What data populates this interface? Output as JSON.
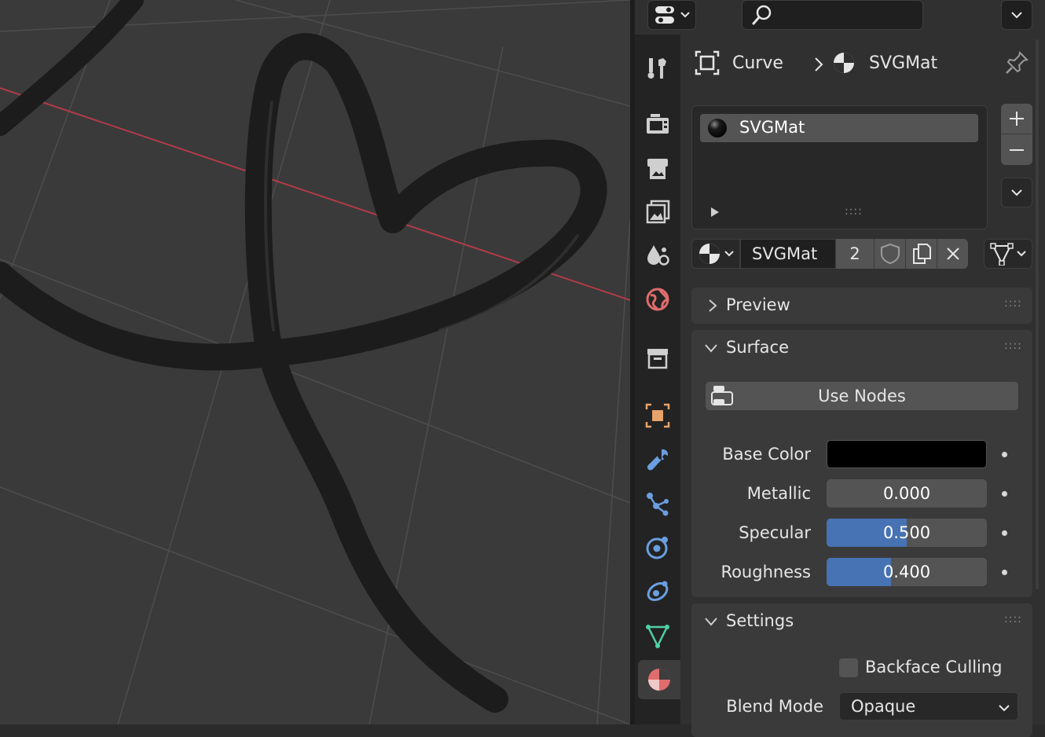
{
  "header": {
    "editor_type_icon": "editor-type-icon",
    "search_placeholder": "",
    "menu_icon": "chevron-down-icon"
  },
  "tabs": [
    {
      "name": "tool",
      "icon": "tool-icon",
      "color": "#cfcfcf"
    },
    {
      "name": "render",
      "icon": "render-icon",
      "color": "#cfcfcf"
    },
    {
      "name": "output",
      "icon": "output-icon",
      "color": "#cfcfcf"
    },
    {
      "name": "view-layer",
      "icon": "view-layer-icon",
      "color": "#cfcfcf"
    },
    {
      "name": "scene",
      "icon": "scene-icon",
      "color": "#cfcfcf"
    },
    {
      "name": "world",
      "icon": "world-icon",
      "color": "#e06c6c"
    },
    {
      "name": "collection",
      "icon": "collection-icon",
      "color": "#cfcfcf"
    },
    {
      "name": "object",
      "icon": "object-icon",
      "color": "#e8a36a"
    },
    {
      "name": "modifiers",
      "icon": "wrench-icon",
      "color": "#6a9ee0"
    },
    {
      "name": "particles",
      "icon": "particles-icon",
      "color": "#6a9ee0"
    },
    {
      "name": "physics",
      "icon": "physics-icon",
      "color": "#6a9ee0"
    },
    {
      "name": "constraints",
      "icon": "constraints-icon",
      "color": "#6a9ee0"
    },
    {
      "name": "data",
      "icon": "curve-data-icon",
      "color": "#4fd1a5"
    },
    {
      "name": "material",
      "icon": "material-icon",
      "color": "#e06c6c"
    }
  ],
  "breadcrumb": {
    "object": "Curve",
    "material": "SVGMat"
  },
  "slots": {
    "items": [
      "SVGMat"
    ]
  },
  "material_selector": {
    "name": "SVGMat",
    "users": "2"
  },
  "sections": {
    "preview": "Preview",
    "surface": "Surface",
    "settings": "Settings"
  },
  "surface": {
    "use_nodes": "Use Nodes",
    "base_color_label": "Base Color",
    "base_color": "#000000",
    "metallic_label": "Metallic",
    "metallic_value": "0.000",
    "metallic_fraction": 0.0,
    "specular_label": "Specular",
    "specular_value": "0.500",
    "specular_fraction": 0.5,
    "roughness_label": "Roughness",
    "roughness_value": "0.400",
    "roughness_fraction": 0.4
  },
  "settings": {
    "backface_culling": "Backface Culling",
    "blend_mode_label": "Blend Mode",
    "blend_mode_value": "Opaque"
  },
  "colors": {
    "accent": "#4772b3",
    "x_axis": "#b23a48"
  }
}
